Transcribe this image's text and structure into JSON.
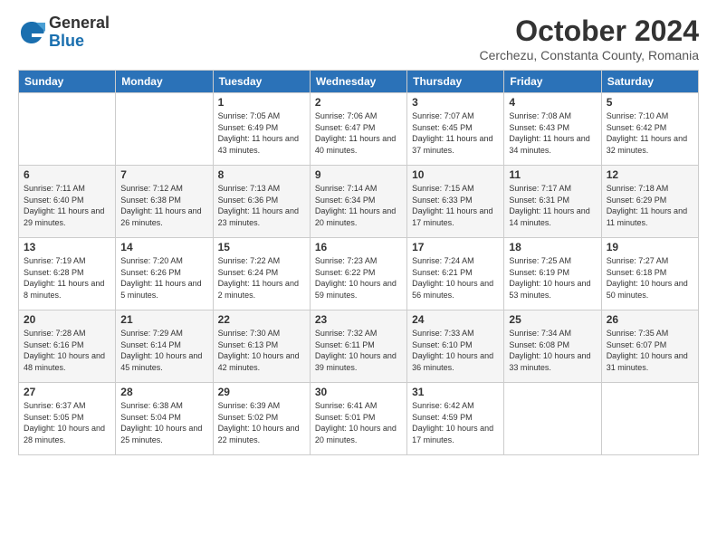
{
  "header": {
    "logo_general": "General",
    "logo_blue": "Blue",
    "month_title": "October 2024",
    "subtitle": "Cerchezu, Constanta County, Romania"
  },
  "weekdays": [
    "Sunday",
    "Monday",
    "Tuesday",
    "Wednesday",
    "Thursday",
    "Friday",
    "Saturday"
  ],
  "weeks": [
    [
      {
        "day": "",
        "info": ""
      },
      {
        "day": "",
        "info": ""
      },
      {
        "day": "1",
        "info": "Sunrise: 7:05 AM\nSunset: 6:49 PM\nDaylight: 11 hours and 43 minutes."
      },
      {
        "day": "2",
        "info": "Sunrise: 7:06 AM\nSunset: 6:47 PM\nDaylight: 11 hours and 40 minutes."
      },
      {
        "day": "3",
        "info": "Sunrise: 7:07 AM\nSunset: 6:45 PM\nDaylight: 11 hours and 37 minutes."
      },
      {
        "day": "4",
        "info": "Sunrise: 7:08 AM\nSunset: 6:43 PM\nDaylight: 11 hours and 34 minutes."
      },
      {
        "day": "5",
        "info": "Sunrise: 7:10 AM\nSunset: 6:42 PM\nDaylight: 11 hours and 32 minutes."
      }
    ],
    [
      {
        "day": "6",
        "info": "Sunrise: 7:11 AM\nSunset: 6:40 PM\nDaylight: 11 hours and 29 minutes."
      },
      {
        "day": "7",
        "info": "Sunrise: 7:12 AM\nSunset: 6:38 PM\nDaylight: 11 hours and 26 minutes."
      },
      {
        "day": "8",
        "info": "Sunrise: 7:13 AM\nSunset: 6:36 PM\nDaylight: 11 hours and 23 minutes."
      },
      {
        "day": "9",
        "info": "Sunrise: 7:14 AM\nSunset: 6:34 PM\nDaylight: 11 hours and 20 minutes."
      },
      {
        "day": "10",
        "info": "Sunrise: 7:15 AM\nSunset: 6:33 PM\nDaylight: 11 hours and 17 minutes."
      },
      {
        "day": "11",
        "info": "Sunrise: 7:17 AM\nSunset: 6:31 PM\nDaylight: 11 hours and 14 minutes."
      },
      {
        "day": "12",
        "info": "Sunrise: 7:18 AM\nSunset: 6:29 PM\nDaylight: 11 hours and 11 minutes."
      }
    ],
    [
      {
        "day": "13",
        "info": "Sunrise: 7:19 AM\nSunset: 6:28 PM\nDaylight: 11 hours and 8 minutes."
      },
      {
        "day": "14",
        "info": "Sunrise: 7:20 AM\nSunset: 6:26 PM\nDaylight: 11 hours and 5 minutes."
      },
      {
        "day": "15",
        "info": "Sunrise: 7:22 AM\nSunset: 6:24 PM\nDaylight: 11 hours and 2 minutes."
      },
      {
        "day": "16",
        "info": "Sunrise: 7:23 AM\nSunset: 6:22 PM\nDaylight: 10 hours and 59 minutes."
      },
      {
        "day": "17",
        "info": "Sunrise: 7:24 AM\nSunset: 6:21 PM\nDaylight: 10 hours and 56 minutes."
      },
      {
        "day": "18",
        "info": "Sunrise: 7:25 AM\nSunset: 6:19 PM\nDaylight: 10 hours and 53 minutes."
      },
      {
        "day": "19",
        "info": "Sunrise: 7:27 AM\nSunset: 6:18 PM\nDaylight: 10 hours and 50 minutes."
      }
    ],
    [
      {
        "day": "20",
        "info": "Sunrise: 7:28 AM\nSunset: 6:16 PM\nDaylight: 10 hours and 48 minutes."
      },
      {
        "day": "21",
        "info": "Sunrise: 7:29 AM\nSunset: 6:14 PM\nDaylight: 10 hours and 45 minutes."
      },
      {
        "day": "22",
        "info": "Sunrise: 7:30 AM\nSunset: 6:13 PM\nDaylight: 10 hours and 42 minutes."
      },
      {
        "day": "23",
        "info": "Sunrise: 7:32 AM\nSunset: 6:11 PM\nDaylight: 10 hours and 39 minutes."
      },
      {
        "day": "24",
        "info": "Sunrise: 7:33 AM\nSunset: 6:10 PM\nDaylight: 10 hours and 36 minutes."
      },
      {
        "day": "25",
        "info": "Sunrise: 7:34 AM\nSunset: 6:08 PM\nDaylight: 10 hours and 33 minutes."
      },
      {
        "day": "26",
        "info": "Sunrise: 7:35 AM\nSunset: 6:07 PM\nDaylight: 10 hours and 31 minutes."
      }
    ],
    [
      {
        "day": "27",
        "info": "Sunrise: 6:37 AM\nSunset: 5:05 PM\nDaylight: 10 hours and 28 minutes."
      },
      {
        "day": "28",
        "info": "Sunrise: 6:38 AM\nSunset: 5:04 PM\nDaylight: 10 hours and 25 minutes."
      },
      {
        "day": "29",
        "info": "Sunrise: 6:39 AM\nSunset: 5:02 PM\nDaylight: 10 hours and 22 minutes."
      },
      {
        "day": "30",
        "info": "Sunrise: 6:41 AM\nSunset: 5:01 PM\nDaylight: 10 hours and 20 minutes."
      },
      {
        "day": "31",
        "info": "Sunrise: 6:42 AM\nSunset: 4:59 PM\nDaylight: 10 hours and 17 minutes."
      },
      {
        "day": "",
        "info": ""
      },
      {
        "day": "",
        "info": ""
      }
    ]
  ]
}
